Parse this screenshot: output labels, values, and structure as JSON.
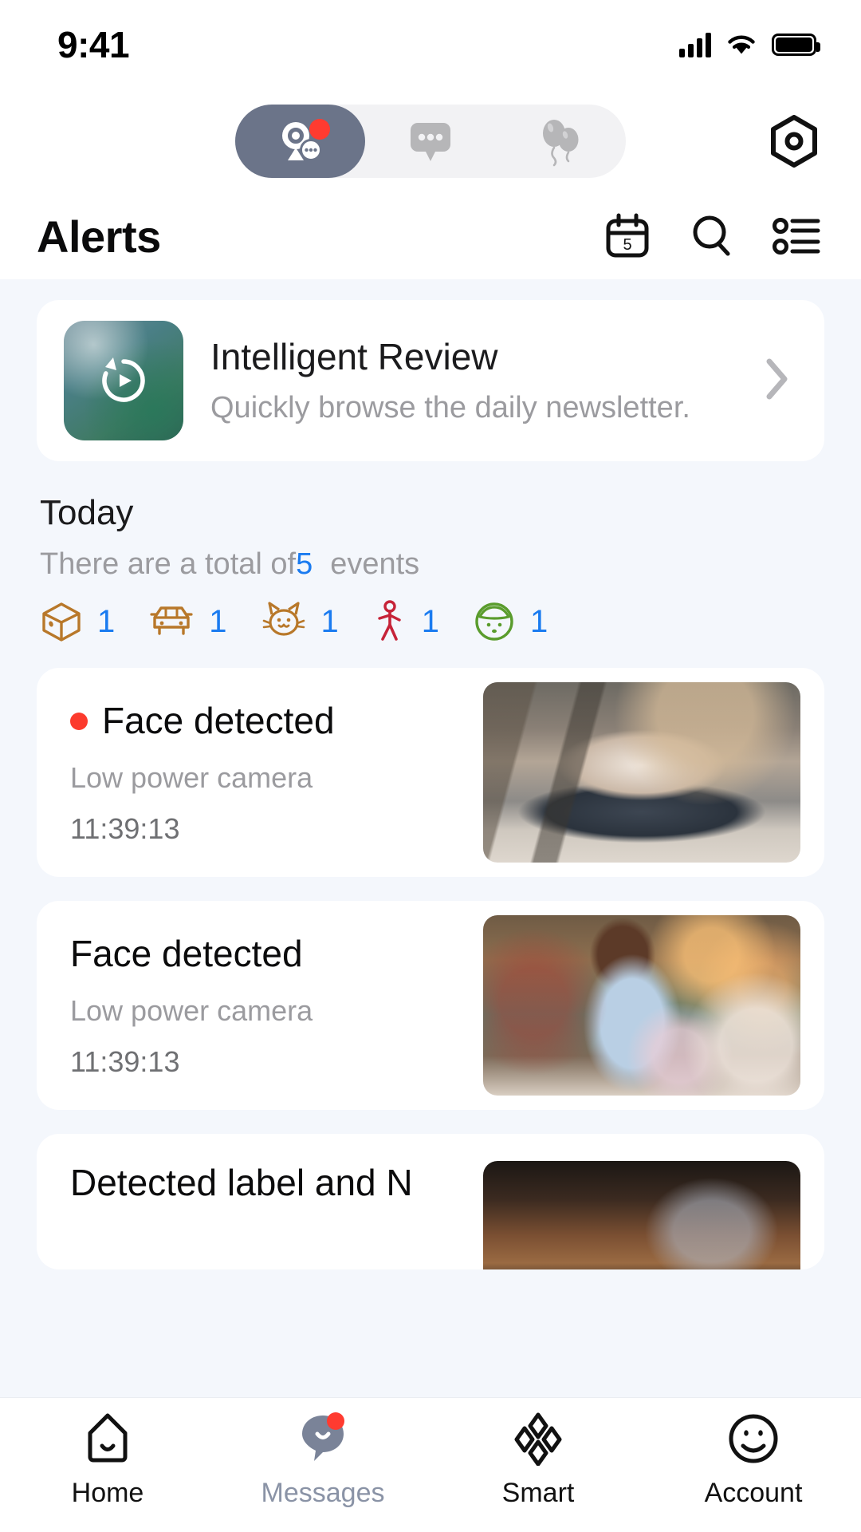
{
  "status_bar": {
    "time": "9:41",
    "signal_icon": "cellular-signal-icon",
    "wifi_icon": "wifi-icon",
    "battery_icon": "battery-full-icon"
  },
  "top_tabs": {
    "items": [
      {
        "id": "alerts",
        "icon": "camera-alert-bubble-icon",
        "active": true,
        "badge": true
      },
      {
        "id": "messages",
        "icon": "message-bubble-icon",
        "active": false,
        "badge": false
      },
      {
        "id": "promotions",
        "icon": "balloons-icon",
        "active": false,
        "badge": false
      }
    ],
    "settings_icon": "settings-gear-icon",
    "active_color": "#6b7489",
    "track_color": "#f2f2f4",
    "badge_color": "#ff3b30"
  },
  "header": {
    "title": "Alerts",
    "actions": [
      {
        "id": "calendar",
        "icon": "calendar-icon",
        "day": "5"
      },
      {
        "id": "search",
        "icon": "search-icon"
      },
      {
        "id": "filter",
        "icon": "filter-list-icon"
      }
    ]
  },
  "banner": {
    "icon": "replay-history-icon",
    "title": "Intelligent Review",
    "subtitle": "Quickly browse the daily newsletter.",
    "chevron_icon": "chevron-right-icon"
  },
  "today": {
    "heading": "Today",
    "summary_prefix": "There are a total of",
    "summary_count": "5",
    "summary_suffix": "events",
    "count_color": "#1a7bf0",
    "types": [
      {
        "id": "package",
        "icon": "package-box-icon",
        "count": "1",
        "color": "#b8782a"
      },
      {
        "id": "vehicle",
        "icon": "car-icon",
        "count": "1",
        "color": "#b8782a"
      },
      {
        "id": "pet",
        "icon": "cat-icon",
        "count": "1",
        "color": "#b8782a"
      },
      {
        "id": "person",
        "icon": "person-walking-icon",
        "count": "1",
        "color": "#c62338"
      },
      {
        "id": "face",
        "icon": "face-head-icon",
        "count": "1",
        "color": "#5a9c2d"
      }
    ]
  },
  "alerts": [
    {
      "title": "Face detected",
      "device": "Low power camera",
      "time": "11:39:13",
      "unread": true,
      "thumb": "cat-on-cushion-photo"
    },
    {
      "title": "Face detected",
      "device": "Low power camera",
      "time": "11:39:13",
      "unread": false,
      "thumb": "woman-with-phone-photo"
    },
    {
      "title": "Detected label and N",
      "device": "",
      "time": "",
      "unread": false,
      "thumb": "dark-interior-photo"
    }
  ],
  "bottom_nav": {
    "items": [
      {
        "id": "home",
        "label": "Home",
        "icon": "home-icon",
        "active": false,
        "badge": false
      },
      {
        "id": "messages",
        "label": "Messages",
        "icon": "message-icon",
        "active": true,
        "badge": true
      },
      {
        "id": "smart",
        "label": "Smart",
        "icon": "smart-diamonds-icon",
        "active": false,
        "badge": false
      },
      {
        "id": "account",
        "label": "Account",
        "icon": "account-face-icon",
        "active": false,
        "badge": false
      }
    ]
  }
}
